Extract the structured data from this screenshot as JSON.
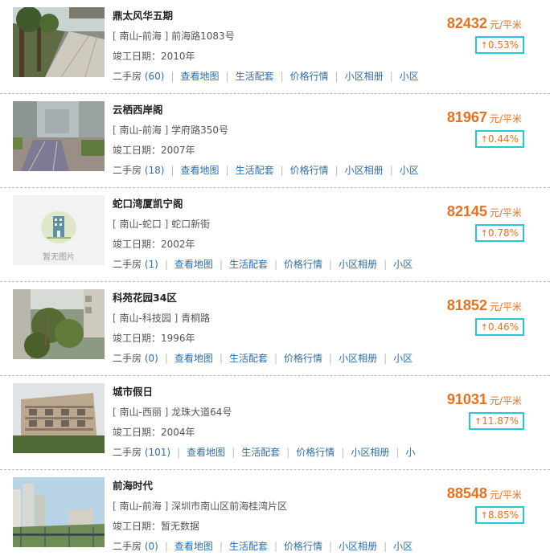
{
  "listings": [
    {
      "name": "鼎太风华五期",
      "district": "南山-前海",
      "street": "前海路1083号",
      "year": "竣工日期：2010年",
      "secondhand_label": "二手房",
      "secondhand_count": "(60)",
      "links": [
        "查看地图",
        "生活配套",
        "价格行情",
        "小区相册",
        "小区"
      ],
      "price": "82432",
      "unit": "元/平米",
      "change": "0.53%",
      "thumb": "walkway"
    },
    {
      "name": "云栖西岸阁",
      "district": "南山-前海",
      "street": "学府路350号",
      "year": "竣工日期：2007年",
      "secondhand_label": "二手房",
      "secondhand_count": "(18)",
      "links": [
        "查看地图",
        "生活配套",
        "价格行情",
        "小区相册",
        "小区"
      ],
      "price": "81967",
      "unit": "元/平米",
      "change": "0.44%",
      "thumb": "plaza"
    },
    {
      "name": "蛇口湾厦凯宁阁",
      "district": "南山-蛇口",
      "street": "蛇口新街",
      "year": "竣工日期：2002年",
      "secondhand_label": "二手房",
      "secondhand_count": "(1)",
      "links": [
        "查看地图",
        "生活配套",
        "价格行情",
        "小区相册",
        "小区"
      ],
      "price": "82145",
      "unit": "元/平米",
      "change": "0.78%",
      "thumb": "noimage",
      "noimage_text": "暂无图片"
    },
    {
      "name": "科苑花园34区",
      "district": "南山-科技园",
      "street": "青桐路",
      "year": "竣工日期：1996年",
      "secondhand_label": "二手房",
      "secondhand_count": "(0)",
      "links": [
        "查看地图",
        "生活配套",
        "价格行情",
        "小区相册",
        "小区"
      ],
      "price": "81852",
      "unit": "元/平米",
      "change": "0.46%",
      "thumb": "garden"
    },
    {
      "name": "城市假日",
      "district": "南山-西丽",
      "street": "龙珠大道64号",
      "year": "竣工日期：2004年",
      "secondhand_label": "二手房",
      "secondhand_count": "(101)",
      "links": [
        "查看地图",
        "生活配套",
        "价格行情",
        "小区相册",
        "小"
      ],
      "price": "91031",
      "unit": "元/平米",
      "change": "11.87%",
      "thumb": "building"
    },
    {
      "name": "前海时代",
      "district": "南山-前海",
      "street": "深圳市南山区前海桂湾片区",
      "year": "竣工日期：暂无数据",
      "secondhand_label": "二手房",
      "secondhand_count": "(0)",
      "links": [
        "查看地图",
        "生活配套",
        "价格行情",
        "小区相册",
        "小区"
      ],
      "price": "88548",
      "unit": "元/平米",
      "change": "8.85%",
      "thumb": "towers"
    }
  ],
  "icons": {
    "up_arrow": "up-arrow-icon"
  },
  "colors": {
    "price": "#e8711f",
    "link": "#2f6fa8",
    "highlight_box": "#27c7d6"
  }
}
